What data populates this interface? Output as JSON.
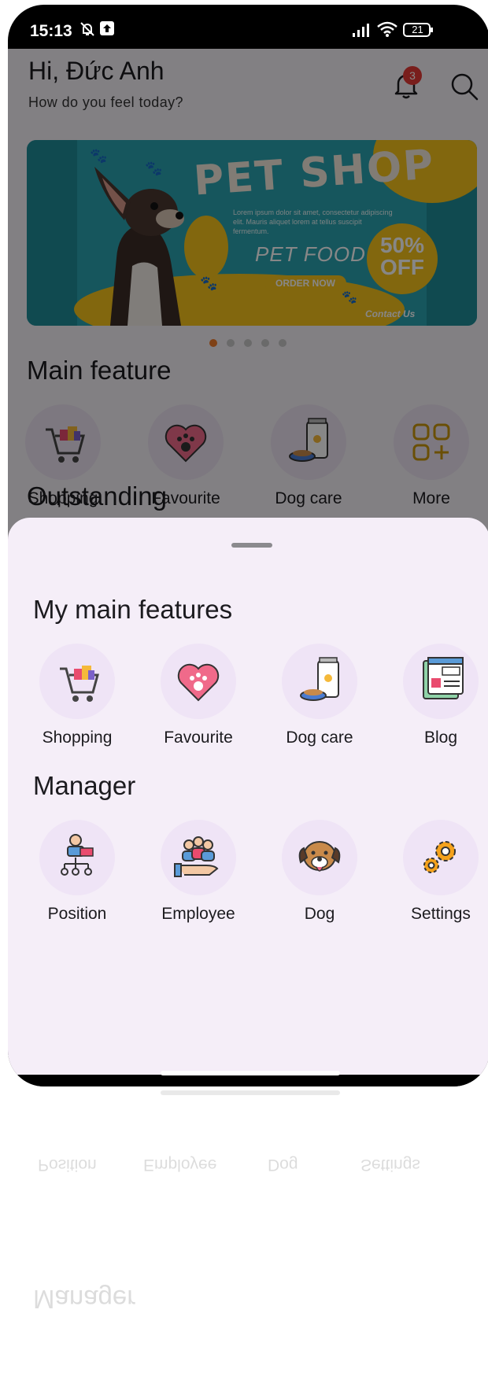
{
  "status_bar": {
    "time": "15:13",
    "battery": "21"
  },
  "header": {
    "title": "Hi, Đức Anh",
    "subtitle": "How do you feel today?",
    "notification_count": "3"
  },
  "banner": {
    "title": "PET SHOP",
    "small_text": "Lorem ipsum dolor sit amet, consectetur adipiscing elit. Mauris aliquet lorem at tellus suscipit fermentum.",
    "food_text": "PET FOOD",
    "order_label": "ORDER NOW",
    "discount_percent": "50%",
    "discount_off": "OFF",
    "contact_label": "Contact Us",
    "carousel_pages": 5,
    "carousel_active_index": 0
  },
  "main_feature": {
    "title": "Main feature",
    "items": [
      {
        "label": "Shopping",
        "icon": "shopping-cart-icon"
      },
      {
        "label": "Favourite",
        "icon": "heart-paw-icon"
      },
      {
        "label": "Dog care",
        "icon": "dog-food-icon"
      },
      {
        "label": "More",
        "icon": "grid-plus-icon"
      }
    ]
  },
  "outstanding": {
    "title": "Outstanding"
  },
  "sheet": {
    "my_features_title": "My main features",
    "my_features": [
      {
        "label": "Shopping",
        "icon": "shopping-cart-icon"
      },
      {
        "label": "Favourite",
        "icon": "heart-paw-icon"
      },
      {
        "label": "Dog care",
        "icon": "dog-food-icon"
      },
      {
        "label": "Blog",
        "icon": "blog-icon"
      }
    ],
    "manager_title": "Manager",
    "manager_items": [
      {
        "label": "Position",
        "icon": "org-chart-icon"
      },
      {
        "label": "Employee",
        "icon": "employee-group-icon"
      },
      {
        "label": "Dog",
        "icon": "dog-face-icon"
      },
      {
        "label": "Settings",
        "icon": "gears-icon"
      }
    ]
  },
  "colors": {
    "accent": "#f07b2a",
    "banner_teal": "#2aa3b0",
    "banner_yellow": "#f5c21b",
    "sheet_bg": "#f5eef8",
    "badge_red": "#e53935"
  }
}
